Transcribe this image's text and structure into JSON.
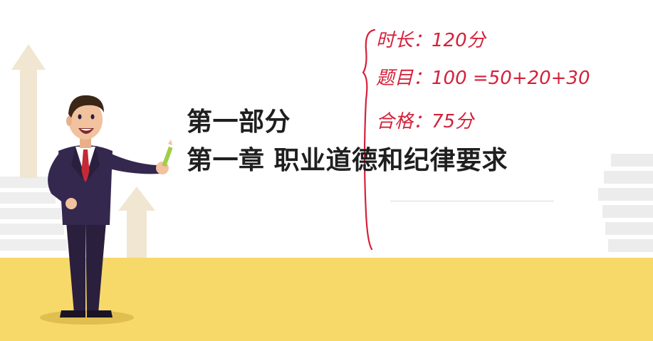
{
  "slide": {
    "part_title": "第一部分",
    "chapter_title": "第一章 职业道德和纪律要求"
  },
  "annotations": {
    "duration": "时长：120分",
    "questions": "题目：100 =50+20+30",
    "pass_score": "合格：75分"
  },
  "colors": {
    "floor": "#f7d96a",
    "ink": "#d4213a",
    "title": "#1f1f1f",
    "arrow": "#f1e6d1",
    "stairs": "#ececec"
  }
}
